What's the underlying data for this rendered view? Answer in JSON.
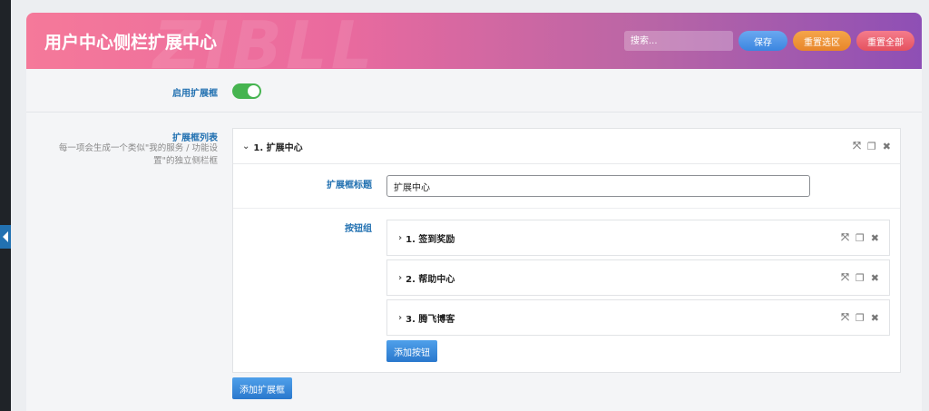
{
  "header": {
    "title": "用户中心侧栏扩展中心",
    "watermark": "ZIBLL",
    "search_placeholder": "搜索...",
    "save_label": "保存",
    "reset_section_label": "重置选区",
    "reset_all_label": "重置全部"
  },
  "enable": {
    "label": "启用扩展框",
    "value": true
  },
  "list": {
    "label": "扩展框列表",
    "description_1": "每一项会生成一个类似\"我的服务 / 功能设",
    "description_2": "置\"的独立侧栏框",
    "boxes": [
      {
        "title": "1. 扩展中心",
        "title_field_label": "扩展框标题",
        "title_value": "扩展中心",
        "button_group_label": "按钮组",
        "buttons": [
          {
            "label": "1. 签到奖励"
          },
          {
            "label": "2. 帮助中心"
          },
          {
            "label": "3. 腾飞博客"
          }
        ],
        "add_button_label": "添加按钮"
      }
    ],
    "add_box_label": "添加扩展框"
  },
  "icons": {
    "expand": "expand-icon",
    "copy": "copy-icon",
    "close": "close-icon"
  },
  "colors": {
    "accent_blue": "#2271b1",
    "toggle_on": "#46b450"
  }
}
